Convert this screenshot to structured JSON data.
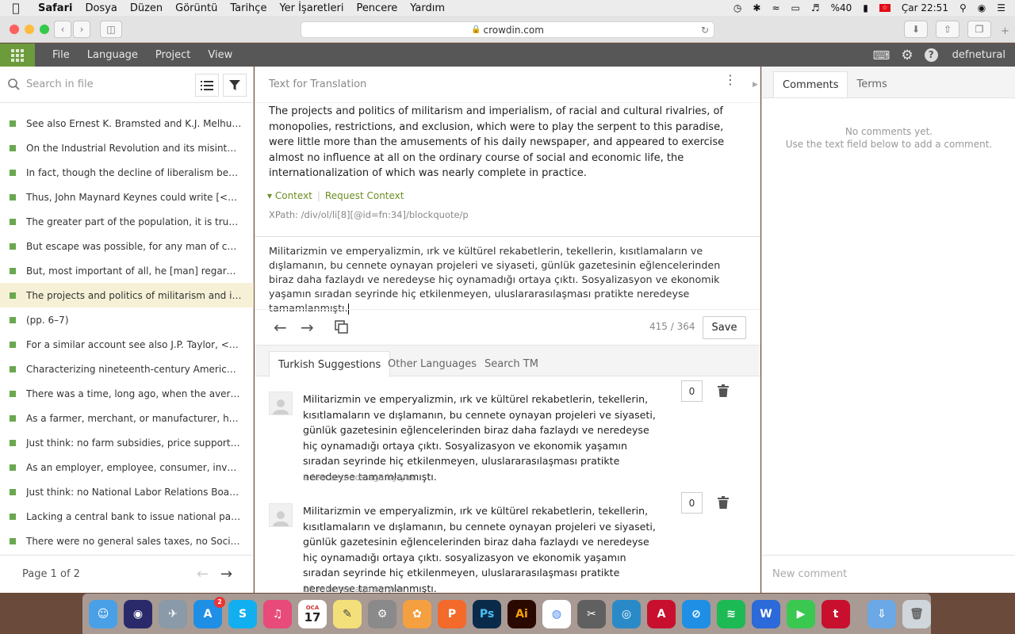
{
  "menubar": {
    "app": "Safari",
    "items": [
      "Dosya",
      "Düzen",
      "Görüntü",
      "Tarihçe",
      "Yer İşaretleri",
      "Pencere",
      "Yardım"
    ],
    "battery": "%40",
    "clock": "Çar 22:51"
  },
  "browser": {
    "url": "crowdin.com"
  },
  "topbar": {
    "menus": [
      "File",
      "Language",
      "Project",
      "View"
    ],
    "username": "defnetural"
  },
  "left": {
    "search_placeholder": "Search in file",
    "strings": [
      "See also Ernest K. Bramsted and K.J. Melhuish, ed...",
      "On the Industrial Revolution and its misinterpret...",
      "In fact, though the decline of liberalism began ar...",
      "Thus, John Maynard Keynes could write [<0>The ...",
      "The greater part of the population, it is true, work...",
      "But escape was possible, for any man of capacity ...",
      "But, most important of all, he [man] regarded thi...",
      "The projects and politics of militarism and imperi...",
      "(pp. 6–7)",
      "For a similar account see also J.P. Taylor, <0>Engli...",
      "Characterizing nineteenth-century America Rober...",
      "There was a time, long ago, when the average A...",
      "As a farmer, merchant, or manufacturer, he coul...",
      "Just think: no farm subsidies, price supports, or a...",
      "As an employer, employee, consumer, investor, l...",
      "Just think: no National Labor Relations Board; no ...",
      "Lacking a central bank to issue national paper cur...",
      "There were no general sales taxes, no Social Secu..."
    ],
    "selected_index": 7,
    "pager": "Page 1 of 2"
  },
  "center": {
    "header": "Text for Translation",
    "source": "The projects and politics of militarism and imperialism, of racial and cultural rivalries, of monopolies, restrictions, and exclusion, which were to play the serpent to this paradise, were little more than the amusements of his daily newspaper, and appeared to exercise almost no influence at all on the ordinary course of social and economic life, the internationalization of which was nearly complete in practice.",
    "context_label": "Context",
    "request_context": "Request Context",
    "xpath": "XPath: /div/ol/li[8][@id=fn:34]/blockquote/p",
    "translation": "Militarizmin ve emperyalizmin, ırk ve kültürel rekabetlerin, tekellerin, kısıtlamaların ve dışlamanın, bu cennete oynayan projeleri ve siyaseti, günlük gazetesinin eğlencelerinden biraz daha fazlaydı ve neredeyse hiç oynamadığı ortaya çıktı. Sosyalizasyon ve ekonomik yaşamın sıradan seyrinde hiç etkilenmeyen, uluslararasılaşması pratikte neredeyse tamamlanmıştı.",
    "counter": "415 / 364",
    "save": "Save",
    "tabs": [
      "Turkish Suggestions",
      "Other Languages",
      "Search TM"
    ],
    "suggestions": [
      {
        "text": "Militarizmin ve emperyalizmin, ırk ve kültürel rekabetlerin, tekellerin, kısıtlamaların ve dışlamanın, bu cennete oynayan projeleri ve siyaseti, günlük gazetesinin eğlencelerinden biraz daha fazlaydı ve neredeyse hiç oynamadığı ortaya çıktı. Sosyalizasyon ve ekonomik yaşamın sıradan seyrinde hiç etkilenmeyen, uluslararasılaşması pratikte neredeyse tamamlanmıştı.",
        "meta": "a few seconds ago by you",
        "votes": "0"
      },
      {
        "text": "Militarizmin ve emperyalizmin, ırk ve kültürel rekabetlerin, tekellerin, kısıtlamaların ve dışlamanın, bu cennete oynayan projeleri ve siyaseti, günlük gazetesinin eğlencelerinden biraz daha fazlaydı ve neredeyse hiç oynamadığı ortaya çıktı. sosyalizasyon ve ekonomik yaşamın sıradan seyrinde hiç etkilenmeyen, uluslararasılaşması pratikte neredeyse tamamlanmıştı.",
        "meta": "16 minutes ago by you",
        "votes": "0"
      }
    ]
  },
  "right": {
    "tabs": [
      "Comments",
      "Terms"
    ],
    "no_comments": "No comments yet.",
    "hint": "Use the text field below to add a comment.",
    "new_comment_placeholder": "New comment"
  },
  "dock": {
    "apps": [
      "Finder",
      "Siri",
      "Preview",
      "App Store",
      "Skype",
      "iTunes",
      "Calendar",
      "Notes",
      "System Preferences",
      "Photos",
      "Pages",
      "Photoshop",
      "Illustrator",
      "Chrome",
      "Image Capture",
      "Aperture",
      "Acrobat",
      "Safari",
      "Spotify",
      "Word",
      "FaceTime",
      "Tumblr",
      "Downloads",
      "Trash"
    ],
    "calendar_day": "17",
    "calendar_month": "OCA",
    "appstore_badge": "2"
  }
}
